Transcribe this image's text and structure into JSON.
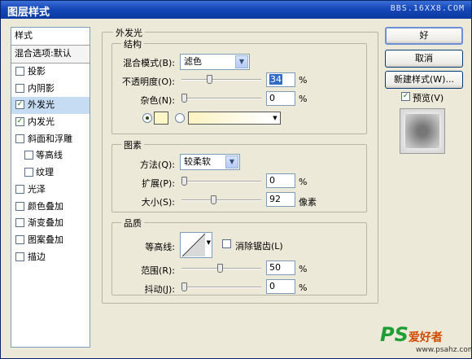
{
  "window": {
    "title": "图层样式",
    "watermark": "BBS.16XX8.COM"
  },
  "styles_panel": {
    "header": "样式",
    "blend_options": "混合选项:默认",
    "items": [
      {
        "label": "投影",
        "checked": false,
        "sub": false,
        "selected": false
      },
      {
        "label": "内阴影",
        "checked": false,
        "sub": false,
        "selected": false
      },
      {
        "label": "外发光",
        "checked": true,
        "sub": false,
        "selected": true
      },
      {
        "label": "内发光",
        "checked": true,
        "sub": false,
        "selected": false
      },
      {
        "label": "斜面和浮雕",
        "checked": false,
        "sub": false,
        "selected": false
      },
      {
        "label": "等高线",
        "checked": false,
        "sub": true,
        "selected": false
      },
      {
        "label": "纹理",
        "checked": false,
        "sub": true,
        "selected": false
      },
      {
        "label": "光泽",
        "checked": false,
        "sub": false,
        "selected": false
      },
      {
        "label": "颜色叠加",
        "checked": false,
        "sub": false,
        "selected": false
      },
      {
        "label": "渐变叠加",
        "checked": false,
        "sub": false,
        "selected": false
      },
      {
        "label": "图案叠加",
        "checked": false,
        "sub": false,
        "selected": false
      },
      {
        "label": "描边",
        "checked": false,
        "sub": false,
        "selected": false
      }
    ]
  },
  "outer_glow": {
    "title": "外发光",
    "structure": {
      "title": "结构",
      "blend_mode_label": "混合模式(B):",
      "blend_mode_value": "滤色",
      "opacity_label": "不透明度(O):",
      "opacity_value": "34",
      "opacity_unit": "%",
      "noise_label": "杂色(N):",
      "noise_value": "0",
      "noise_unit": "%",
      "color_swatch": "#fdf6c8",
      "gradient_colors": [
        "#fbf3c0",
        "#ffffff"
      ]
    },
    "elements": {
      "title": "图素",
      "technique_label": "方法(Q):",
      "technique_value": "较柔软",
      "spread_label": "扩展(P):",
      "spread_value": "0",
      "spread_unit": "%",
      "size_label": "大小(S):",
      "size_value": "92",
      "size_unit": "像素"
    },
    "quality": {
      "title": "品质",
      "contour_label": "等高线:",
      "anti_alias_label": "消除锯齿(L)",
      "range_label": "范围(R):",
      "range_value": "50",
      "range_unit": "%",
      "jitter_label": "抖动(J):",
      "jitter_value": "0",
      "jitter_unit": "%"
    }
  },
  "buttons": {
    "ok": "好",
    "cancel": "取消",
    "new_style": "新建样式(W)...",
    "preview_label": "预览(V)",
    "preview_checked": true
  },
  "footer": {
    "logo_ps": "PS",
    "logo_cn": "爱好者",
    "url": "www.psahz.com"
  }
}
